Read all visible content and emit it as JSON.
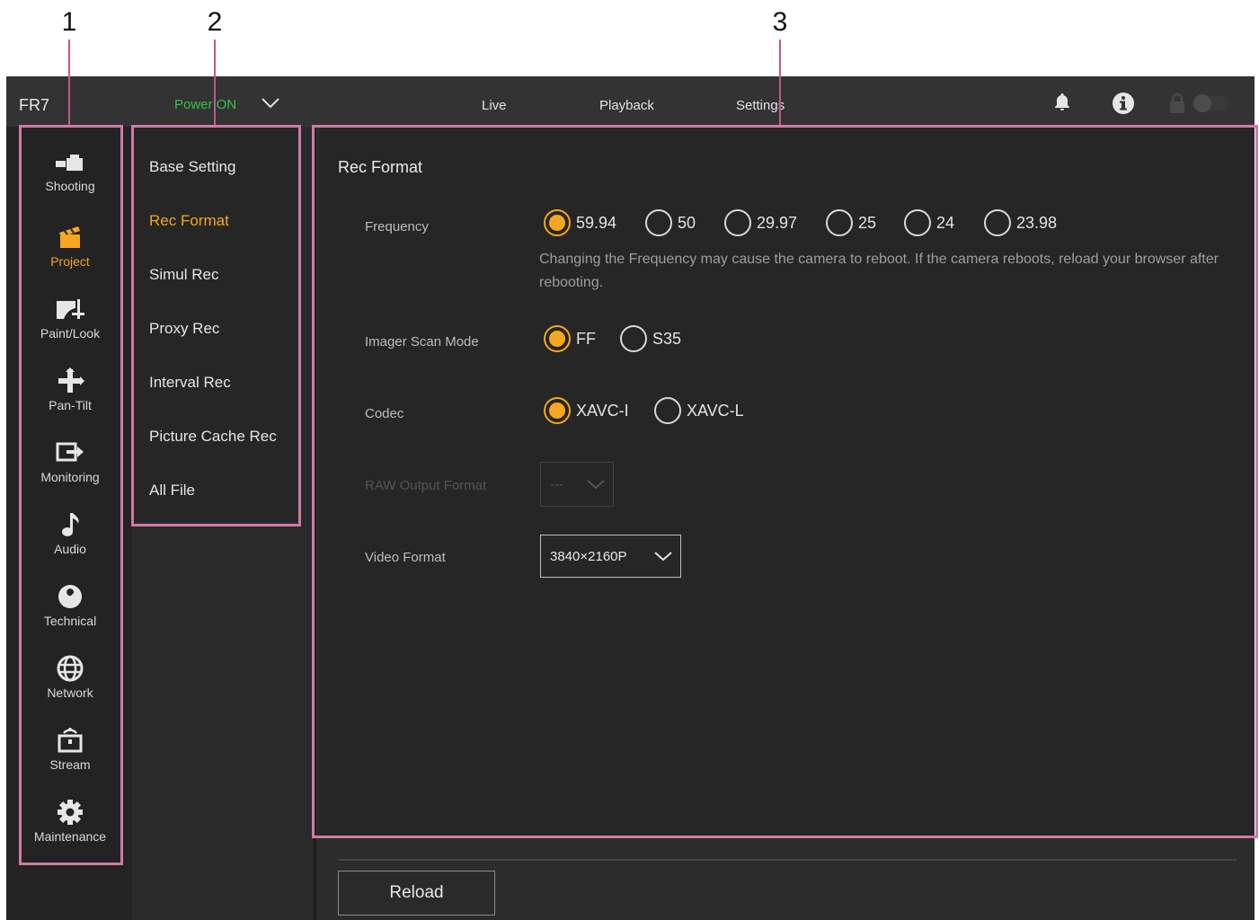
{
  "callouts": [
    "1",
    "2",
    "3"
  ],
  "topbar": {
    "app_title": "FR7",
    "power_label": "Power ON",
    "tabs": [
      "Live",
      "Playback",
      "Settings"
    ],
    "icons": [
      "bell-icon",
      "info-icon",
      "lock-icon",
      "toggle-switch"
    ]
  },
  "sidebar": {
    "items": [
      {
        "label": "Shooting",
        "icon": "camera-icon"
      },
      {
        "label": "Project",
        "icon": "clapperboard-icon",
        "active": true
      },
      {
        "label": "Paint/Look",
        "icon": "paint-look-icon"
      },
      {
        "label": "Pan-Tilt",
        "icon": "pan-tilt-icon"
      },
      {
        "label": "Monitoring",
        "icon": "monitoring-icon"
      },
      {
        "label": "Audio",
        "icon": "music-note-icon"
      },
      {
        "label": "Technical",
        "icon": "wrench-icon"
      },
      {
        "label": "Network",
        "icon": "globe-icon"
      },
      {
        "label": "Stream",
        "icon": "stream-icon"
      },
      {
        "label": "Maintenance",
        "icon": "gear-icon"
      }
    ]
  },
  "submenu": {
    "items": [
      {
        "label": "Base Setting"
      },
      {
        "label": "Rec Format",
        "active": true
      },
      {
        "label": "Simul Rec"
      },
      {
        "label": "Proxy Rec"
      },
      {
        "label": "Interval Rec"
      },
      {
        "label": "Picture Cache Rec"
      },
      {
        "label": "All File"
      }
    ]
  },
  "main": {
    "title": "Rec Format",
    "frequency": {
      "label": "Frequency",
      "options": [
        "59.94",
        "50",
        "29.97",
        "25",
        "24",
        "23.98"
      ],
      "selected": "59.94",
      "note": "Changing the Frequency may cause the camera to reboot. If the camera reboots, reload your browser after rebooting."
    },
    "imager_scan_mode": {
      "label": "Imager Scan Mode",
      "options": [
        "FF",
        "S35"
      ],
      "selected": "FF"
    },
    "codec": {
      "label": "Codec",
      "options": [
        "XAVC-I",
        "XAVC-L"
      ],
      "selected": "XAVC-I"
    },
    "raw_output_format": {
      "label": "RAW Output Format",
      "value": "---",
      "disabled": true
    },
    "video_format": {
      "label": "Video Format",
      "value": "3840×2160P"
    }
  },
  "footer": {
    "reload_label": "Reload"
  },
  "colors": {
    "accent": "#f5a623",
    "power_on": "#35c24a",
    "callout": "#d07aa6"
  }
}
